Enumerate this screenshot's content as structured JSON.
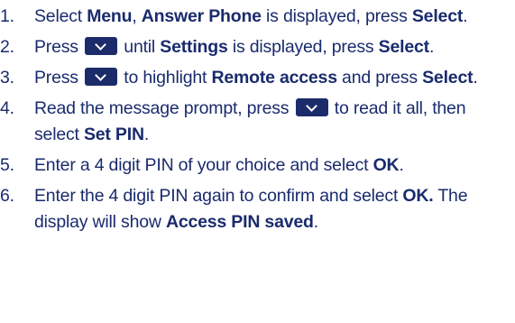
{
  "steps": [
    {
      "number": "1.",
      "a": "Select ",
      "b1": "Menu",
      "c": ", ",
      "b2": "Answer Phone",
      "d": " is displayed, press ",
      "b3": "Select",
      "e": "."
    },
    {
      "number": "2.",
      "a": "Press ",
      "key_icon": "down-arrow-key",
      "b": " until ",
      "b1": "Settings",
      "c": " is displayed, press ",
      "b2": "Select",
      "d": "."
    },
    {
      "number": "3.",
      "a": "Press ",
      "key_icon": "down-arrow-key",
      "b": " to highlight ",
      "b1": "Remote access",
      "c": " and press ",
      "b2": "Select",
      "d": "."
    },
    {
      "number": "4.",
      "a": "Read the message prompt, press ",
      "key_icon": "down-arrow-key",
      "b": " to read it all, then select ",
      "b1": "Set PIN",
      "c": "."
    },
    {
      "number": "5.",
      "a": "Enter a 4 digit PIN of your choice and select ",
      "b1": "OK",
      "c": "."
    },
    {
      "number": "6.",
      "a": "Enter the 4 digit PIN again to confirm and select ",
      "b1": "OK.",
      "b": " The display will show ",
      "b2": "Access PIN saved",
      "c": "."
    }
  ],
  "colors": {
    "text": "#1a2b6d",
    "key_background": "#1c2c6b",
    "key_arrow": "#ffffff"
  }
}
